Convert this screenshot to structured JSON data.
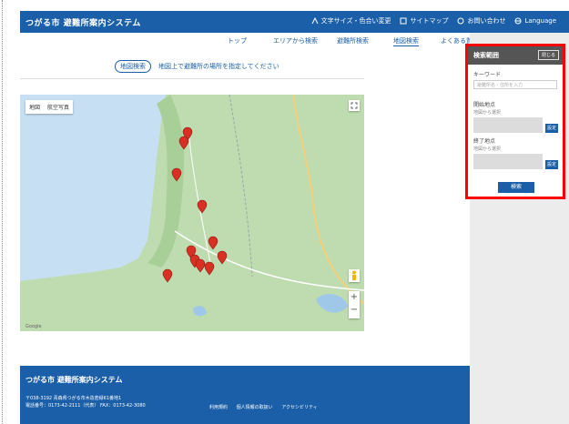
{
  "header": {
    "brand": "つがる市 避難所案内システム",
    "links": [
      "文字サイズ・色合い変更",
      "サイトマップ",
      "お問い合わせ",
      "Language"
    ]
  },
  "nav": {
    "items": [
      "トップ",
      "エリアから検索",
      "避難所検索",
      "地図検索",
      "よくある質問"
    ],
    "active_index": 3
  },
  "main": {
    "badge": "地図検索",
    "message": "地図上で避難所の場所を指定してください"
  },
  "map": {
    "type_options": [
      "地図",
      "航空写真"
    ],
    "footer_text": "Google",
    "zoom_in": "+",
    "zoom_out": "−",
    "pin_color": "#d93025"
  },
  "panel": {
    "title": "検索範囲",
    "close_label": "閉じる",
    "keyword_label": "キーワード",
    "keyword_placeholder": "避難所名・住所を入力",
    "start_label": "開始地点",
    "start_hint": "地図から選択",
    "end_label": "終了地点",
    "end_hint": "地図から選択",
    "set_label": "設定",
    "search_button": "検索"
  },
  "footer": {
    "brand": "つがる市 避難所案内システム",
    "address_lines": [
      "〒038-3192 青森県つがる市木造若緑61番地1",
      "電話番号：0173-42-2111（代表） FAX：0173-42-3080"
    ],
    "links": [
      "利用規約",
      "個人情報の取扱い",
      "アクセシビリティ"
    ]
  },
  "colors": {
    "brand_blue": "#1a5fa8",
    "highlight_red": "#ff0000"
  }
}
